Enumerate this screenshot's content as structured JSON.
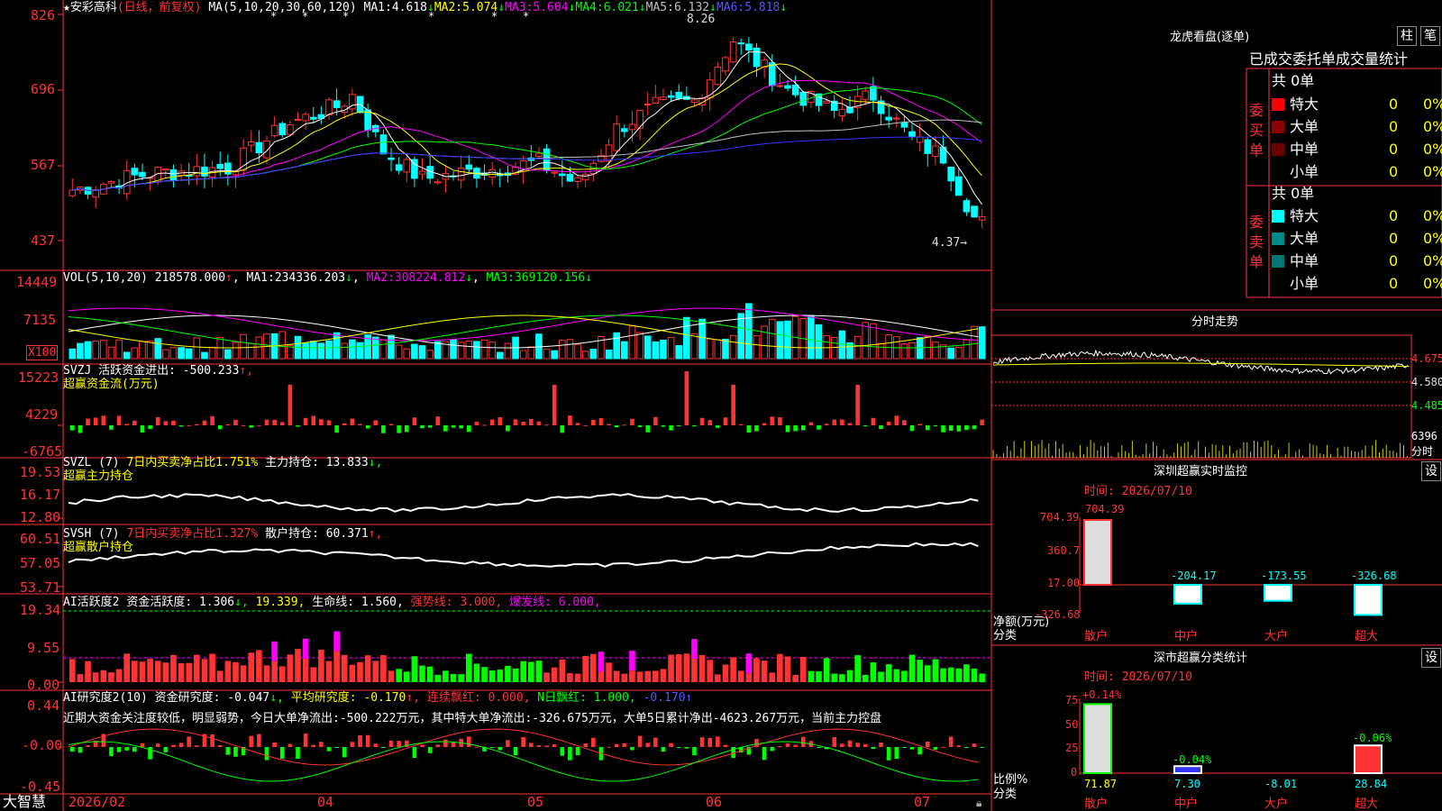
{
  "app": {
    "logo": "大智慧"
  },
  "stock": {
    "marker": "★",
    "name": "安彩高科",
    "period": "(日线，前复权)"
  },
  "axis": {
    "price_ticks": [
      "826",
      "696",
      "567",
      "437"
    ],
    "vol_ticks": [
      "14449",
      "7135"
    ],
    "vol_unit": "X100",
    "svzj_ticks": [
      "15223",
      "4229",
      "-6765"
    ],
    "svzl_ticks": [
      "19.53",
      "16.17",
      "12.80"
    ],
    "svsh_ticks": [
      "60.51",
      "57.05",
      "53.71"
    ],
    "ai1_ticks": [
      "19.34",
      "9.55",
      "0.00"
    ],
    "ai2_ticks": [
      "0.44",
      "-0.00",
      "-0.45"
    ],
    "date_labels": [
      "2026/02",
      "04",
      "05",
      "06",
      "07"
    ]
  },
  "ma": {
    "label": "MA(5,10,20,30,60,120)",
    "items": [
      {
        "name": "MA1:",
        "value": "4.618",
        "arrow": "↓",
        "color": "#ffffff"
      },
      {
        "name": "MA2:",
        "value": "5.074",
        "arrow": "↓",
        "color": "#ffff00"
      },
      {
        "name": "MA3:",
        "value": "5.604",
        "arrow": "↓",
        "color": "#ff00ff"
      },
      {
        "name": "MA4:",
        "value": "6.021",
        "arrow": "↓",
        "color": "#00ff00"
      },
      {
        "name": "MA5:",
        "value": "6.132",
        "arrow": "↓",
        "color": "#c0c0c0"
      },
      {
        "name": "MA6:",
        "value": "5.818",
        "arrow": "↓",
        "color": "#3333ff"
      }
    ]
  },
  "price_markers": {
    "high": "8.26",
    "low": "4.37→"
  },
  "vol": {
    "label": "VOL(5,10,20)",
    "value": "218578.000",
    "arrow": "↑",
    "items": [
      {
        "name": "MA1:",
        "value": "234336.203",
        "arrow": "↓",
        "color": "#ffffff"
      },
      {
        "name": "MA2:",
        "value": "308224.812",
        "arrow": "↓",
        "color": "#ff00ff"
      },
      {
        "name": "MA3:",
        "value": "369120.156",
        "arrow": "↓",
        "color": "#00ff00"
      }
    ]
  },
  "svzj": {
    "label": "SVZJ",
    "text": "活跃资金进出:",
    "value": "-500.233",
    "arrow": "↑,",
    "subtitle": "超赢资金流(万元)"
  },
  "svzl": {
    "label": "SVZL (7)",
    "text1": "7日内买卖净占比1.751%",
    "text2": "主力持仓:",
    "value": "13.833",
    "arrow": "↓,",
    "subtitle": "超赢主力持仓"
  },
  "svsh": {
    "label": "SVSH (7)",
    "text1": "7日内买卖净占比1.327%",
    "text2": "散户持仓:",
    "value": "60.371",
    "arrow": "↑,",
    "subtitle": "超赢散户持仓"
  },
  "ai1": {
    "label": "AI活跃度2",
    "text": "资金活跃度:",
    "value": "1.306",
    "arrow": "↓,",
    "v2": "19.339,",
    "l3": "生命线:",
    "v3": "1.560,",
    "l4": "强势线:",
    "v4": "3.000,",
    "l5": "爆发线:",
    "v5": "6.000,"
  },
  "ai2": {
    "label": "AI研究度2(10)",
    "text": "资金研究度:",
    "value": "-0.047",
    "arrow": "↓,",
    "l2": "平均研究度:",
    "v2": "-0.170",
    "a2": "↑,",
    "l3": "连续飘红:",
    "v3": "0.000,",
    "l4": "N日飘红:",
    "v4": "1.000,",
    "v5": "-0.170↑",
    "comment": "近期大资金关注度较低，明显弱势，今日大单净流出:-500.222万元，其中特大单净流出:-326.675万元，大单5日累计净出-4623.267万元，当前主力控盘"
  },
  "right": {
    "title": "龙虎看盘(逐单)",
    "btn1": "柱",
    "btn2": "笔",
    "subtitle": "已成交委托单成交量统计",
    "buy_label": "委买单",
    "sell_label": "委卖单",
    "buy_total": "共 0单",
    "sell_total": "共 0单",
    "buy_rows": [
      {
        "label": "特大",
        "value": "0",
        "pct": "0%",
        "color": "#ff0000"
      },
      {
        "label": "大单",
        "value": "0",
        "pct": "0%",
        "color": "#8b0000"
      },
      {
        "label": "中单",
        "value": "0",
        "pct": "0%",
        "color": "#6b0000"
      },
      {
        "label": "小单",
        "value": "0",
        "pct": "0%",
        "color": "#000000"
      }
    ],
    "sell_rows": [
      {
        "label": "特大",
        "value": "0",
        "pct": "0%",
        "color": "#00ffff"
      },
      {
        "label": "大单",
        "value": "0",
        "pct": "0%",
        "color": "#008b8b"
      },
      {
        "label": "中单",
        "value": "0",
        "pct": "0%",
        "color": "#007777"
      },
      {
        "label": "小单",
        "value": "0",
        "pct": "0%",
        "color": "#000000"
      }
    ]
  },
  "intraday": {
    "title": "分时走势",
    "ticks": [
      "4.675",
      "4.580",
      "4.485"
    ],
    "vol_top": "6396",
    "vol_label": "分时"
  },
  "monitor": {
    "title": "深圳超赢实时监控",
    "btn": "设",
    "time": "时间: 2026/07/10",
    "yticks": [
      "704.39",
      "360.7",
      "17.00",
      "-326.68"
    ],
    "ylabel": "净额(万元)",
    "xlabel": "分类",
    "top_label": "704.39",
    "bars": [
      {
        "cat": "散户",
        "value": 704.39,
        "label": ""
      },
      {
        "cat": "中户",
        "value": -204.17,
        "label": "-204.17"
      },
      {
        "cat": "大户",
        "value": -173.55,
        "label": "-173.55"
      },
      {
        "cat": "超大",
        "value": -326.68,
        "label": "-326.68"
      }
    ]
  },
  "stats": {
    "title": "深市超赢分类统计",
    "btn": "设",
    "time": "时间: 2026/07/10",
    "yticks": [
      "75",
      "50",
      "25",
      "0"
    ],
    "ylabel": "比例%",
    "xlabel": "分类",
    "cats": [
      {
        "cat": "散户",
        "bottom": "71.87",
        "delta": "+0.14%",
        "ratio": 71.87
      },
      {
        "cat": "中户",
        "bottom": "7.30",
        "delta": "-0.04%",
        "ratio": 7.3
      },
      {
        "cat": "大户",
        "bottom": "-8.01",
        "delta": "",
        "ratio": 0
      },
      {
        "cat": "超大",
        "bottom": "28.84",
        "delta": "-0.06%",
        "ratio": 28.84
      }
    ]
  },
  "chart_data": [
    {
      "type": "candlestick",
      "ylim": [
        4.37,
        8.26
      ],
      "high": 8.26,
      "low": 4.37,
      "ma_last": [
        4.618,
        5.074,
        5.604,
        6.021,
        6.132,
        5.818
      ]
    },
    {
      "type": "bar",
      "name": "VOL",
      "last": 218578.0,
      "ma_last": [
        234336.203,
        308224.812,
        369120.156
      ],
      "ylim": [
        0,
        14449
      ]
    },
    {
      "type": "bar",
      "name": "SVZJ",
      "last": -500.233,
      "ylim": [
        -6765,
        15223
      ]
    },
    {
      "type": "line",
      "name": "SVZL",
      "last": 13.833,
      "ylim": [
        12.8,
        19.53
      ]
    },
    {
      "type": "line",
      "name": "SVSH",
      "last": 60.371,
      "ylim": [
        53.71,
        60.51
      ]
    },
    {
      "type": "bar",
      "name": "AI活跃度2",
      "last": 1.306,
      "ylim": [
        0,
        19.34
      ]
    },
    {
      "type": "bar",
      "name": "AI研究度2",
      "last": -0.047,
      "ylim": [
        -0.45,
        0.44
      ]
    },
    {
      "type": "bar",
      "name": "深圳超赢实时监控",
      "categories": [
        "散户",
        "中户",
        "大户",
        "超大"
      ],
      "values": [
        704.39,
        -204.17,
        -173.55,
        -326.68
      ],
      "ylim": [
        -326.68,
        704.39
      ]
    },
    {
      "type": "bar",
      "name": "深市超赢分类统计",
      "categories": [
        "散户",
        "中户",
        "大户",
        "超大"
      ],
      "values": [
        71.87,
        7.3,
        -8.01,
        28.84
      ]
    }
  ]
}
